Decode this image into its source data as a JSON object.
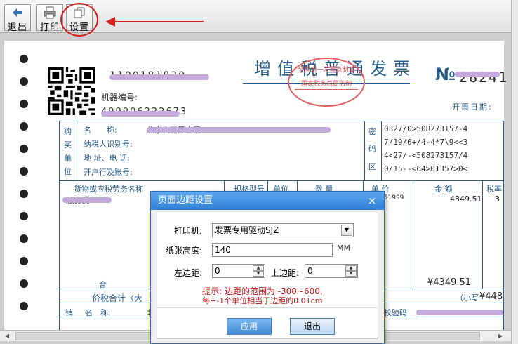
{
  "toolbar": {
    "buttons": [
      {
        "label": "退出",
        "icon": "back-arrow-icon"
      },
      {
        "label": "打印",
        "icon": "printer-icon"
      },
      {
        "label": "设置",
        "icon": "settings-page-icon"
      }
    ]
  },
  "invoice": {
    "title": "增值税普通发票",
    "seal_top": "全国统一发票监制章",
    "seal_bottom": "国家税务总局监制",
    "invoice_code": "1100181820",
    "number_prefix": "№",
    "number": "28241",
    "machine_no_label": "机器编号:",
    "machine_no": "499906222673",
    "date_label": "开票日期:",
    "buyer_side": [
      "购",
      "买",
      "单",
      "位"
    ],
    "buyer_fields": [
      "名　　称:",
      "纳税人识别号:",
      "地 址、电 话:",
      "开户行及账号:"
    ],
    "buyer_name": "北京市石景山区*******",
    "cipher_side": [
      "密",
      "码",
      "区"
    ],
    "cipher_lines": [
      "0327/0>508273157-4",
      "7/19/6+/4-4*7\\9<<3",
      "4<27/-<508273157/4",
      "0/15--<64>01357>0<"
    ],
    "col_headers": [
      "货物或应税劳务名称",
      "规格型号",
      "单位",
      "数 量",
      "单 价",
      "金 额",
      "税率"
    ],
    "item_name": "*服务费*",
    "unit_price": "4349.51999",
    "amount": "4349.51",
    "tax_rate": "3",
    "total_label": "合",
    "total_amount": "¥4349.51",
    "grand_total_label": "价税合计（大",
    "small_label": "（小写",
    "small_amount": "¥448",
    "seller_fields": [
      "销",
      "名　称:",
      "北"
    ],
    "check_code_label": "校验码"
  },
  "dialog": {
    "title": "页面边距设置",
    "close": "×",
    "printer_label": "打印机:",
    "printer_value": "发票专用驱动SJZ",
    "paper_height_label": "纸张高度:",
    "paper_height_value": "140",
    "paper_height_unit": "MM",
    "left_margin_label": "左边距:",
    "left_margin_value": "0",
    "top_margin_label": "上边距:",
    "top_margin_value": "0",
    "hint_line1": "提示: 边距的范围为 -300~600,",
    "hint_line2": "每+-1个单位相当于边距的0.01cm",
    "ok_label": "应用",
    "cancel_label": "退出"
  },
  "colors": {
    "accent_red": "#d42020",
    "invoice_blue": "#2a5d8a",
    "dialog_title_blue": "#2f7fd4"
  }
}
